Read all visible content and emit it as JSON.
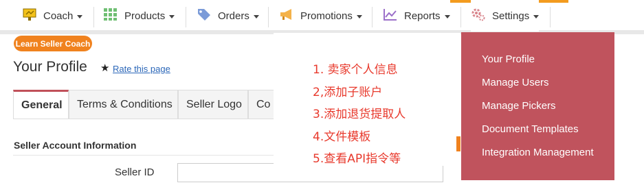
{
  "nav": {
    "coach": "Coach",
    "products": "Products",
    "orders": "Orders",
    "promotions": "Promotions",
    "reports": "Reports",
    "settings": "Settings"
  },
  "coach_button": "Learn Seller Coach",
  "page_title": "Your Profile",
  "rate_link": "Rate this page",
  "tabs": [
    "General",
    "Terms & Conditions",
    "Seller Logo",
    "Co"
  ],
  "section_title": "Seller Account Information",
  "seller_id_label": "Seller ID",
  "annotation": [
    "1. 卖家个人信息",
    "2,添加子账户",
    "3.添加退货提取人",
    "4.文件模板",
    "5.查看API指令等"
  ],
  "settings_menu": [
    "Your Profile",
    "Manage Users",
    "Manage Pickers",
    "Document Templates",
    "Integration Management"
  ],
  "colors": {
    "accent_orange": "#f0821e",
    "menu_bg": "#c0535d",
    "annotation_red": "#e8392c",
    "link_blue": "#2a66b8"
  },
  "icons": {
    "coach": "coach-icon",
    "products": "grid-icon",
    "orders": "tag-icon",
    "promotions": "megaphone-icon",
    "reports": "chart-icon",
    "settings": "gears-icon",
    "rate": "star-icon"
  }
}
